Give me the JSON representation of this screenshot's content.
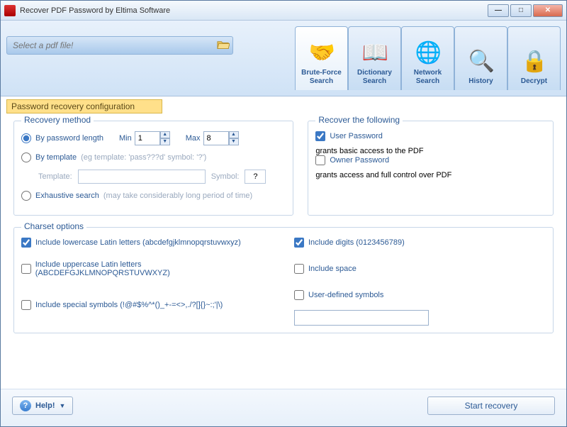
{
  "window": {
    "title": "Recover PDF Password by Eltima Software"
  },
  "file_picker": {
    "placeholder": "Select a pdf file!"
  },
  "tabs": [
    {
      "label": "Brute-Force\nSearch",
      "icon": "handshake-icon",
      "active": true
    },
    {
      "label": "Dictionary\nSearch",
      "icon": "book-icon",
      "active": false
    },
    {
      "label": "Network\nSearch",
      "icon": "globe-icon",
      "active": false
    },
    {
      "label": "History",
      "icon": "magnifier-icon",
      "active": false
    },
    {
      "label": "Decrypt",
      "icon": "lock-icon",
      "active": false
    }
  ],
  "config_banner": "Password recovery configuration",
  "recovery_method": {
    "legend": "Recovery method",
    "by_length_label": "By password length",
    "min_label": "Min",
    "min_value": "1",
    "max_label": "Max",
    "max_value": "8",
    "by_template_label": "By template",
    "by_template_hint": "(eg template: 'pass???d' symbol: '?')",
    "template_caption": "Template:",
    "template_value": "",
    "symbol_caption": "Symbol:",
    "symbol_value": "?",
    "exhaustive_label": "Exhaustive search",
    "exhaustive_hint": "(may take considerably long period of time)",
    "selected": "by_length"
  },
  "recover_following": {
    "legend": "Recover the following",
    "user_pw_label": "User Password",
    "user_pw_hint": "grants basic access to the PDF",
    "user_pw_checked": true,
    "owner_pw_label": "Owner Password",
    "owner_pw_hint": "grants access and full control over PDF",
    "owner_pw_checked": false
  },
  "charset": {
    "legend": "Charset options",
    "lowercase_label": "Include lowercase Latin letters (abcdefgjklmnopqrstuvwxyz)",
    "lowercase_checked": true,
    "uppercase_label": "Include uppercase Latin letters (ABCDEFGJKLMNOPQRSTUVWXYZ)",
    "uppercase_checked": false,
    "special_label": "Include special symbols (!@#$%^*()_+-=<>,./?[]{}~:;'|\\)",
    "special_checked": false,
    "digits_label": "Include digits (0123456789)",
    "digits_checked": true,
    "space_label": "Include space",
    "space_checked": false,
    "userdef_label": "User-defined symbols",
    "userdef_checked": false,
    "userdef_value": ""
  },
  "footer": {
    "help_label": "Help!",
    "start_label": "Start recovery"
  },
  "icons": {
    "handshake-icon": "🤝",
    "book-icon": "📖",
    "globe-icon": "🌐",
    "magnifier-icon": "🔍",
    "lock-icon": "🔒"
  }
}
